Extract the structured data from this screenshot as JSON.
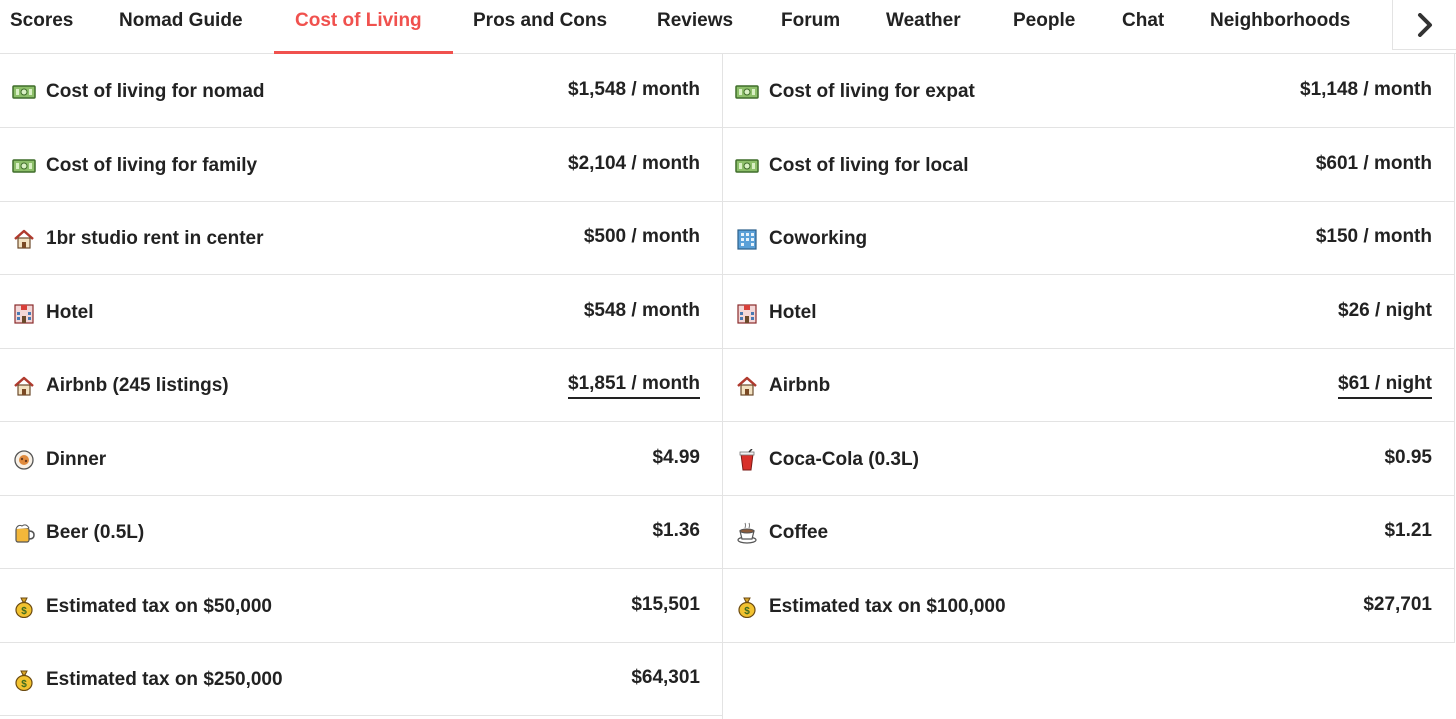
{
  "tabs": [
    {
      "label": "Scores"
    },
    {
      "label": "Nomad Guide"
    },
    {
      "label": "Cost of Living"
    },
    {
      "label": "Pros and Cons"
    },
    {
      "label": "Reviews"
    },
    {
      "label": "Forum"
    },
    {
      "label": "Weather"
    },
    {
      "label": "People"
    },
    {
      "label": "Chat"
    },
    {
      "label": "Neighborhoods"
    }
  ],
  "active_tab": "Cost of Living",
  "colors": {
    "accent": "#f0514e",
    "text": "#222222",
    "border": "#e3e3e3"
  },
  "rows": {
    "nomad": {
      "icon": "money-icon",
      "label": "Cost of living for nomad",
      "value": "$1,548 / month"
    },
    "expat": {
      "icon": "money-icon",
      "label": "Cost of living for expat",
      "value": "$1,148 / month"
    },
    "family": {
      "icon": "money-icon",
      "label": "Cost of living for family",
      "value": "$2,104 / month"
    },
    "local": {
      "icon": "money-icon",
      "label": "Cost of living for local",
      "value": "$601 / month"
    },
    "studio": {
      "icon": "house-icon",
      "label": "1br studio rent in center",
      "value": "$500 / month"
    },
    "coworking": {
      "icon": "office-building-icon",
      "label": "Coworking",
      "value": "$150 / month"
    },
    "hotel_month": {
      "icon": "hotel-icon",
      "label": "Hotel",
      "value": "$548 / month"
    },
    "hotel_night": {
      "icon": "hotel-icon",
      "label": "Hotel",
      "value": "$26 / night"
    },
    "airbnb_month": {
      "icon": "house-icon",
      "label": "Airbnb (245 listings)",
      "value": "$1,851 / month"
    },
    "airbnb_night": {
      "icon": "house-icon",
      "label": "Airbnb",
      "value": "$61 / night"
    },
    "dinner": {
      "icon": "dinner-icon",
      "label": "Dinner",
      "value": "$4.99"
    },
    "cola": {
      "icon": "cup-icon",
      "label": "Coca-Cola (0.3L)",
      "value": "$0.95"
    },
    "beer": {
      "icon": "beer-icon",
      "label": "Beer (0.5L)",
      "value": "$1.36"
    },
    "coffee": {
      "icon": "coffee-icon",
      "label": "Coffee",
      "value": "$1.21"
    },
    "tax50": {
      "icon": "money-bag-icon",
      "label": "Estimated tax on $50,000",
      "value": "$15,501"
    },
    "tax100": {
      "icon": "money-bag-icon",
      "label": "Estimated tax on $100,000",
      "value": "$27,701"
    },
    "tax250": {
      "icon": "money-bag-icon",
      "label": "Estimated tax on $250,000",
      "value": "$64,301"
    }
  }
}
